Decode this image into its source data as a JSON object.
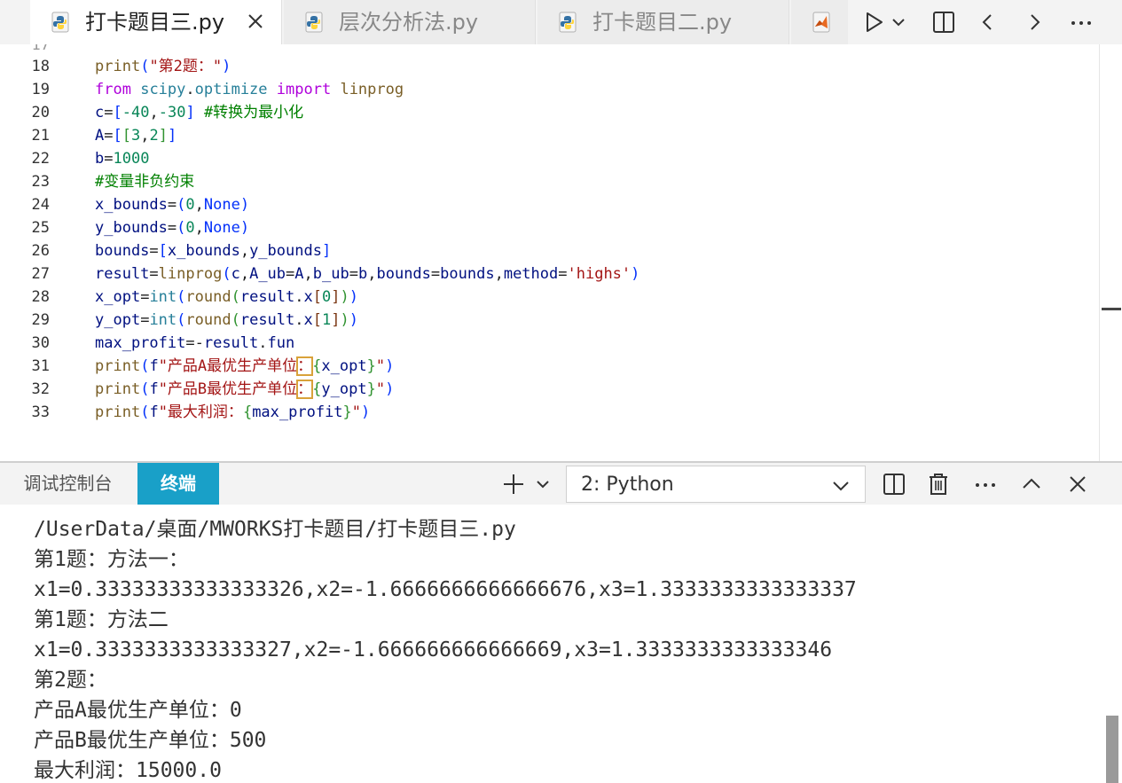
{
  "tabs": [
    {
      "label": "打卡题目三.py",
      "active": true
    },
    {
      "label": "层次分析法.py",
      "active": false
    },
    {
      "label": "打卡题目二.py",
      "active": false
    }
  ],
  "editor": {
    "line_numbers": [
      "18",
      "19",
      "20",
      "21",
      "22",
      "23",
      "24",
      "25",
      "26",
      "27",
      "28",
      "29",
      "30",
      "31",
      "32",
      "33"
    ],
    "tokens": {
      "print": "print",
      "from": "from",
      "import": "import",
      "scipy": "scipy",
      "optimize": "optimize",
      "linprog": "linprog",
      "q2_str": "\"第2题：\"",
      "c": "c",
      "A": "A",
      "b": "b",
      "n_neg40": "-40",
      "n_neg30": "-30",
      "n0": "0",
      "n1": "1",
      "n2": "2",
      "n3": "3",
      "n1000": "1000",
      "cm_min": "#转换为最小化",
      "cm_nonneg": "#变量非负约束",
      "x_bounds": "x_bounds",
      "y_bounds": "y_bounds",
      "None": "None",
      "bounds": "bounds",
      "result": "result",
      "A_ub": "A_ub",
      "b_ub": "b_ub",
      "method": "method",
      "highs": "'highs'",
      "x_opt": "x_opt",
      "y_opt": "y_opt",
      "int": "int",
      "round": "round",
      "x": "x",
      "max_profit": "max_profit",
      "fun": "fun",
      "f": "f",
      "sa_1": "\"产品A最优生产单位",
      "sa_2": "：",
      "sb_1": "\"产品B最优生产单位",
      "sb_2": "：",
      "sc_1": "\"最大利润：",
      "q_end": "\""
    }
  },
  "panel": {
    "tabs": [
      {
        "label": "调试控制台",
        "active": false
      },
      {
        "label": "终端",
        "active": true
      }
    ],
    "terminal_select": "2: Python"
  },
  "terminal": {
    "lines": [
      "/UserData/桌面/MWORKS打卡题目/打卡题目三.py",
      "第1题：方法一：",
      "x1=0.33333333333333326,x2=-1.6666666666666676,x3=1.3333333333333337",
      "第1题：方法二",
      "x1=0.3333333333333327,x2=-1.666666666666669,x3=1.3333333333333346",
      "第2题：",
      "产品A最优生产单位：0",
      "产品B最优生产单位：500",
      "最大利润：15000.0"
    ]
  },
  "icons": {
    "tabs": [
      "python-file-icon",
      "close-icon"
    ],
    "actions": [
      "matlab-file-icon",
      "run-icon",
      "chevron-down-icon",
      "split-editor-icon",
      "arrow-left-icon",
      "arrow-right-icon",
      "more-icon"
    ],
    "panel": [
      "plus-icon",
      "chevron-down-icon",
      "split-terminal-icon",
      "trash-icon",
      "more-icon",
      "chevron-up-icon",
      "close-icon"
    ]
  },
  "colors": {
    "accent": "#19a0c8",
    "keyword": "#af00db",
    "variable": "#001080",
    "function": "#795e26",
    "number": "#098658",
    "string": "#a31515",
    "comment": "#008000",
    "builtin": "#267f99",
    "highlight": "#d9a23a"
  }
}
